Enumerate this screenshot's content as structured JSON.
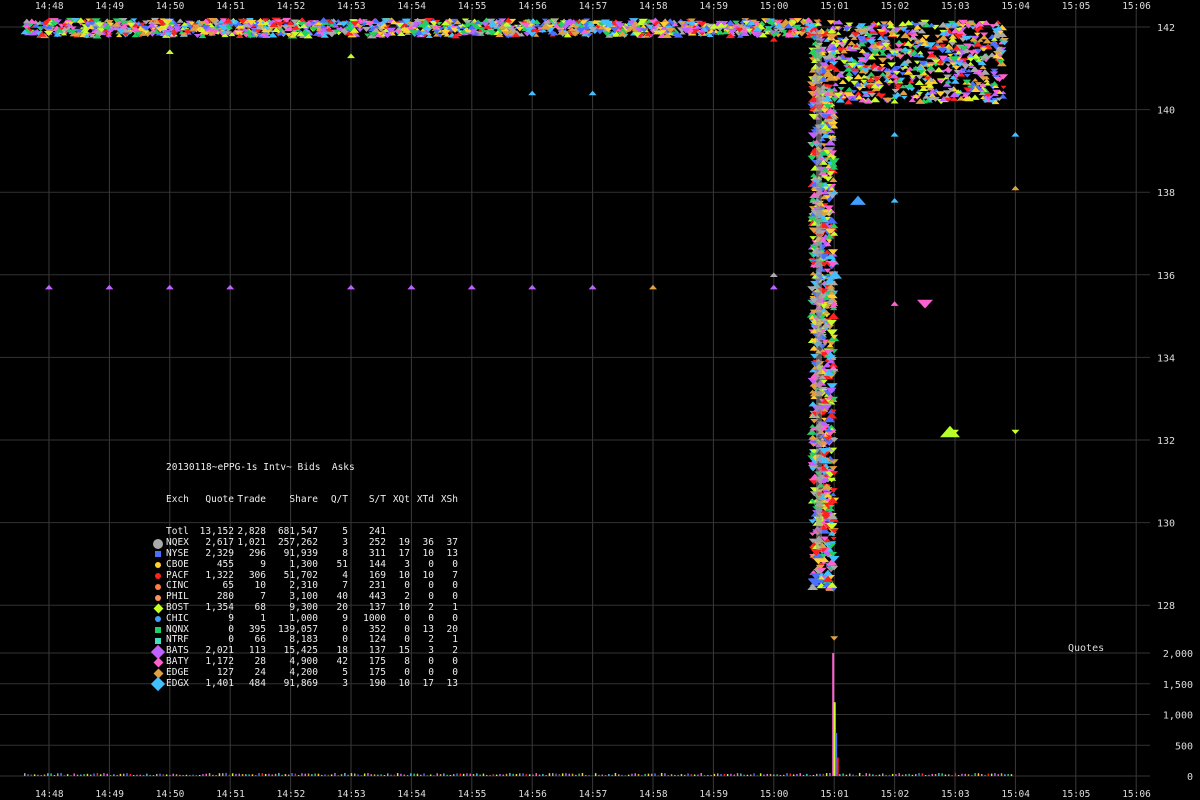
{
  "chart_data": [
    {
      "type": "scatter",
      "name": "",
      "x_ticks": [
        "14:48",
        "14:49",
        "14:50",
        "14:51",
        "14:52",
        "14:53",
        "14:54",
        "14:55",
        "14:56",
        "14:57",
        "14:58",
        "14:59",
        "15:00",
        "15:01",
        "15:02",
        "15:03",
        "15:04",
        "15:05",
        "15:06"
      ],
      "y_ticks": [
        128,
        130,
        132,
        134,
        136,
        138,
        140,
        142
      ],
      "ylim": [
        126.5,
        142.4
      ],
      "grid": true,
      "series": [
        {
          "name": "NQEX",
          "color": "#aaaaaa",
          "points": [
            [
              15.01,
              135.8
            ],
            [
              15.01,
              132.0
            ],
            [
              15.01,
              128.9
            ],
            [
              15.0,
              136.0
            ]
          ]
        },
        {
          "name": "NYSE",
          "color": "#4b6fff",
          "points": [
            [
              14.48,
              142.0
            ],
            [
              14.55,
              142.0
            ],
            [
              15.01,
              141.5
            ],
            [
              15.02,
              141.0
            ]
          ]
        },
        {
          "name": "PACF",
          "color": "#ff2020",
          "points": [
            [
              14.52,
              142.1
            ],
            [
              15.01,
              129.8
            ],
            [
              15.01,
              131.2
            ],
            [
              15.0,
              141.7
            ]
          ]
        },
        {
          "name": "BOST",
          "color": "#c8ff2a",
          "points": [
            [
              14.5,
              141.4
            ],
            [
              14.53,
              141.3
            ],
            [
              15.01,
              137.0
            ],
            [
              15.03,
              132.2
            ],
            [
              15.035,
              132.2
            ],
            [
              15.02,
              140.2
            ]
          ]
        },
        {
          "name": "BATS",
          "color": "#c060ff",
          "points": [
            [
              14.48,
              135.7
            ],
            [
              14.49,
              135.7
            ],
            [
              14.5,
              135.7
            ],
            [
              14.51,
              135.7
            ],
            [
              14.53,
              135.7
            ],
            [
              14.54,
              135.7
            ],
            [
              14.55,
              135.7
            ],
            [
              14.56,
              135.7
            ],
            [
              14.57,
              135.7
            ],
            [
              15.0,
              135.7
            ]
          ]
        },
        {
          "name": "BATY",
          "color": "#ff60d0",
          "points": [
            [
              15.01,
              135.3
            ],
            [
              15.02,
              135.3
            ],
            [
              15.01,
              136.0
            ]
          ]
        },
        {
          "name": "EDGE",
          "color": "#e0a040",
          "points": [
            [
              14.58,
              135.7
            ],
            [
              15.04,
              138.1
            ],
            [
              15.01,
              127.2
            ]
          ]
        },
        {
          "name": "EDGX",
          "color": "#40c0ff",
          "points": [
            [
              14.56,
              140.4
            ],
            [
              14.57,
              140.4
            ],
            [
              15.02,
              139.4
            ],
            [
              15.04,
              139.4
            ],
            [
              15.01,
              138.0
            ],
            [
              15.02,
              137.8
            ]
          ]
        },
        {
          "name": "NQNX",
          "color": "#20d060",
          "points": [
            [
              15.01,
              138.6
            ],
            [
              15.01,
              133.0
            ]
          ]
        },
        {
          "name": "CBOE",
          "color": "#ffd030",
          "points": [
            [
              15.01,
              139.6
            ],
            [
              15.01,
              134.5
            ]
          ]
        }
      ]
    },
    {
      "type": "bar",
      "name": "",
      "ylabel": "Quotes",
      "y_ticks": [
        "0",
        "500",
        "1,000",
        "1,500",
        "2,000"
      ],
      "ylim": [
        0,
        2100
      ],
      "peak": {
        "x": "15:01",
        "value": 2000
      }
    }
  ],
  "legend": {
    "title": "20130118~ePPG-1s Intv~ Bids  Asks",
    "headers": [
      "Exch",
      "Quote",
      "Trade",
      "Share",
      "Q/T",
      "S/T",
      "XQt",
      "XTd",
      "XSh"
    ],
    "rows": [
      {
        "exch": "Totl",
        "quote": "13,152",
        "trade": "2,828",
        "share": "681,547",
        "qt": "5",
        "st": "241",
        "xq": "",
        "xt": "",
        "xs": "",
        "color": "",
        "marker": "none"
      },
      {
        "exch": "NQEX",
        "quote": "2,617",
        "trade": "1,021",
        "share": "257,262",
        "qt": "3",
        "st": "252",
        "xq": "19",
        "xt": "36",
        "xs": "37",
        "color": "#aaaaaa",
        "marker": "bigdot"
      },
      {
        "exch": "NYSE",
        "quote": "2,329",
        "trade": "296",
        "share": "91,939",
        "qt": "8",
        "st": "311",
        "xq": "17",
        "xt": "10",
        "xs": "13",
        "color": "#4b6fff",
        "marker": "sq"
      },
      {
        "exch": "CBOE",
        "quote": "455",
        "trade": "9",
        "share": "1,300",
        "qt": "51",
        "st": "144",
        "xq": "3",
        "xt": "0",
        "xs": "0",
        "color": "#ffd030",
        "marker": "dot"
      },
      {
        "exch": "PACF",
        "quote": "1,322",
        "trade": "306",
        "share": "51,702",
        "qt": "4",
        "st": "169",
        "xq": "10",
        "xt": "10",
        "xs": "7",
        "color": "#ff2020",
        "marker": "dot"
      },
      {
        "exch": "CINC",
        "quote": "65",
        "trade": "10",
        "share": "2,310",
        "qt": "7",
        "st": "231",
        "xq": "0",
        "xt": "0",
        "xs": "0",
        "color": "#ff8040",
        "marker": "dot"
      },
      {
        "exch": "PHIL",
        "quote": "280",
        "trade": "7",
        "share": "3,100",
        "qt": "40",
        "st": "443",
        "xq": "2",
        "xt": "0",
        "xs": "0",
        "color": "#ff9060",
        "marker": "dot"
      },
      {
        "exch": "BOST",
        "quote": "1,354",
        "trade": "68",
        "share": "9,300",
        "qt": "20",
        "st": "137",
        "xq": "10",
        "xt": "2",
        "xs": "1",
        "color": "#c8ff2a",
        "marker": "dia"
      },
      {
        "exch": "CHIC",
        "quote": "9",
        "trade": "1",
        "share": "1,000",
        "qt": "9",
        "st": "1000",
        "xq": "0",
        "xt": "0",
        "xs": "0",
        "color": "#40a0ff",
        "marker": "dot"
      },
      {
        "exch": "NQNX",
        "quote": "0",
        "trade": "395",
        "share": "139,057",
        "qt": "0",
        "st": "352",
        "xq": "0",
        "xt": "13",
        "xs": "20",
        "color": "#20d060",
        "marker": "sq"
      },
      {
        "exch": "NTRF",
        "quote": "0",
        "trade": "66",
        "share": "8,183",
        "qt": "0",
        "st": "124",
        "xq": "0",
        "xt": "2",
        "xs": "1",
        "color": "#40e0c0",
        "marker": "sq"
      },
      {
        "exch": "BATS",
        "quote": "2,021",
        "trade": "113",
        "share": "15,425",
        "qt": "18",
        "st": "137",
        "xq": "15",
        "xt": "3",
        "xs": "2",
        "color": "#c060ff",
        "marker": "bigdia"
      },
      {
        "exch": "BATY",
        "quote": "1,172",
        "trade": "28",
        "share": "4,900",
        "qt": "42",
        "st": "175",
        "xq": "8",
        "xt": "0",
        "xs": "0",
        "color": "#ff60d0",
        "marker": "dia"
      },
      {
        "exch": "EDGE",
        "quote": "127",
        "trade": "24",
        "share": "4,200",
        "qt": "5",
        "st": "175",
        "xq": "0",
        "xt": "0",
        "xs": "0",
        "color": "#e0a040",
        "marker": "dia"
      },
      {
        "exch": "EDGX",
        "quote": "1,401",
        "trade": "484",
        "share": "91,869",
        "qt": "3",
        "st": "190",
        "xq": "10",
        "xt": "17",
        "xs": "13",
        "color": "#40c0ff",
        "marker": "bigdia"
      }
    ]
  }
}
